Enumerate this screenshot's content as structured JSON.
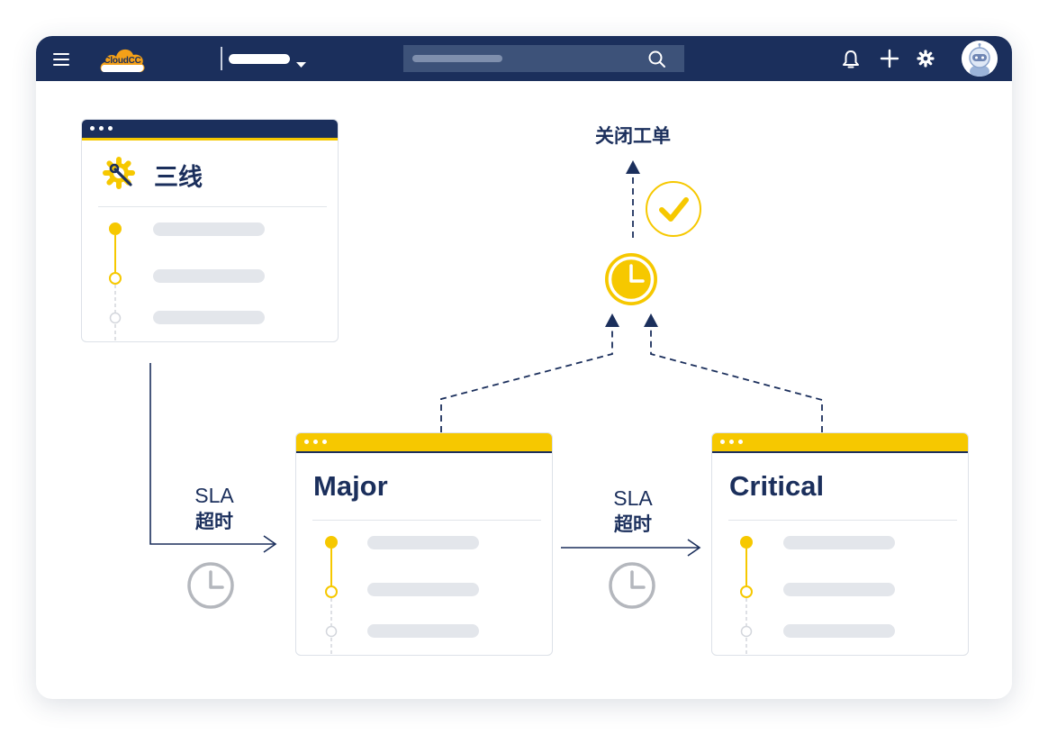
{
  "app": {
    "logo_text": "CloudCC"
  },
  "topbar": {
    "menu_icon": "hamburger-icon",
    "search_icon": "search-icon",
    "actions": [
      "bell-icon",
      "plus-icon",
      "gear-icon"
    ],
    "avatar_icon": "robot-avatar"
  },
  "tiers": {
    "level3": {
      "title": "三线",
      "icon": "gear-wrench-icon"
    },
    "major": {
      "title": "Major"
    },
    "critical": {
      "title": "Critical"
    }
  },
  "flow": {
    "sla_label_1": "SLA",
    "timeout_label_1": "超时",
    "sla_label_2": "SLA",
    "timeout_label_2": "超时",
    "close_ticket_label": "关闭工单"
  },
  "colors": {
    "navy": "#1b2f5c",
    "accent_yellow": "#f6c800",
    "gray_icon": "#b4b7bd"
  }
}
